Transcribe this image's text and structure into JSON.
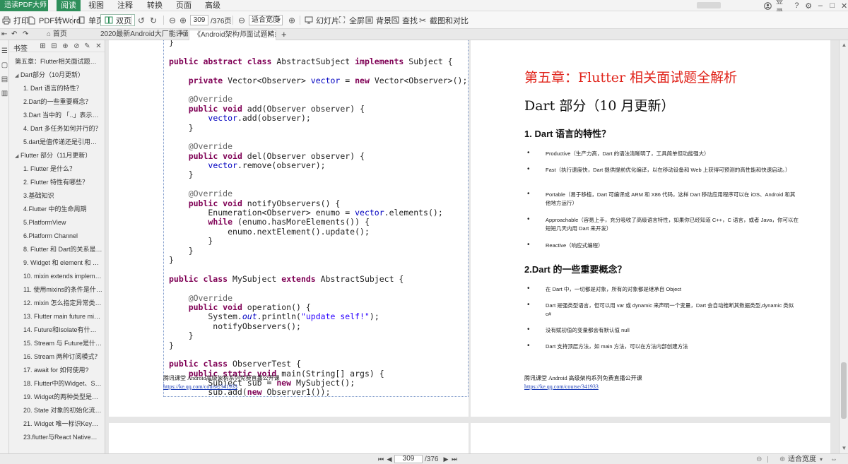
{
  "app": {
    "name": "迅读PDF大师",
    "accent": "#2f8f5b"
  },
  "menubar": {
    "items": [
      "阅读",
      "视图",
      "注释",
      "转换",
      "页面",
      "高级"
    ],
    "active_index": 0,
    "right": {
      "login_label": "登录"
    }
  },
  "toolbar": {
    "print_label": "打印",
    "pdf2word_label": "PDF转Word",
    "single_page_label": "单页",
    "double_page_label": "双页",
    "current_page": "309",
    "total_pages": "/376页",
    "zoom_value": "适合宽度",
    "slideshow_label": "幻灯片",
    "fullscreen_label": "全屏",
    "background_label": "背景",
    "find_label": "查找",
    "screenshot_label": "截图和对比"
  },
  "tabs": {
    "home_label": "首页",
    "items": [
      {
        "label": "2020最新Android大厂能评面..."
      },
      {
        "label": "《Android架构师面试题精编..."
      }
    ],
    "active_index": 1
  },
  "bookmarks": {
    "title": "书签",
    "items": [
      {
        "label": "第五章：Flutter相关面试题全解析",
        "level": 0,
        "expanded": false
      },
      {
        "label": "Dart部分（10月更新）",
        "level": 0,
        "expanded": true
      },
      {
        "label": "1. Dart 语言的特性？",
        "level": 1
      },
      {
        "label": "2.Dart的一些重要概念？",
        "level": 1
      },
      {
        "label": "3.Dart 当中的 「..」表示什么...",
        "level": 1
      },
      {
        "label": "4. Dart 多任务如何并行的？",
        "level": 1
      },
      {
        "label": "5.dart是值传递还是引用传递？",
        "level": 1
      },
      {
        "label": "Flutter 部分（11月更新）",
        "level": 0,
        "expanded": true
      },
      {
        "label": "1. Flutter 是什么？",
        "level": 1
      },
      {
        "label": "2. Flutter 特性有哪些？",
        "level": 1
      },
      {
        "label": "3.基础知识",
        "level": 1
      },
      {
        "label": "4.Flutter 中的生命周期",
        "level": 1
      },
      {
        "label": "5.PlatformView",
        "level": 1
      },
      {
        "label": "6.Platform Channel",
        "level": 1
      },
      {
        "label": "8. Flutter 和 Dart的关系是什...",
        "level": 1
      },
      {
        "label": "9. Widget 和 element 和 Re...",
        "level": 1
      },
      {
        "label": "10. mixin extends implemen...",
        "level": 1
      },
      {
        "label": "11. 使用mixins的条件是什么？",
        "level": 1
      },
      {
        "label": "12. mixin 怎么指定异常类型？",
        "level": 1
      },
      {
        "label": "13. Flutter main future mirot...",
        "level": 1
      },
      {
        "label": "14. Future和Isolate有什么区...",
        "level": 1
      },
      {
        "label": "15. Stream 与 Future是什么...",
        "level": 1
      },
      {
        "label": "16. Stream 两种订阅模式？",
        "level": 1
      },
      {
        "label": "17. await for 如何使用?",
        "level": 1
      },
      {
        "label": "18. Flutter中的Widget、Stat...",
        "level": 1
      },
      {
        "label": "19. Widget的两种类型是什么？",
        "level": 1
      },
      {
        "label": "20. State 对象的初始化流程？",
        "level": 1
      },
      {
        "label": "21. Widget 唯一标识Key有那...",
        "level": 1
      },
      {
        "label": "23.flutter与React Native有什...",
        "level": 1
      }
    ]
  },
  "left_page": {
    "code_lines": [
      [
        [
          "p",
          "}"
        ]
      ],
      [
        [
          "p",
          ""
        ]
      ],
      [
        [
          "k",
          "public abstract class"
        ],
        [
          "p",
          " AbstractSubject "
        ],
        [
          "k",
          "implements"
        ],
        [
          "p",
          " Subject {"
        ]
      ],
      [
        [
          "p",
          ""
        ]
      ],
      [
        [
          "p",
          "    "
        ],
        [
          "k",
          "private"
        ],
        [
          "p",
          " Vector<Observer> "
        ],
        [
          "f",
          "vector"
        ],
        [
          "p",
          " = "
        ],
        [
          "k",
          "new"
        ],
        [
          "p",
          " Vector<Observer>();"
        ]
      ],
      [
        [
          "p",
          ""
        ]
      ],
      [
        [
          "a",
          "    @Override"
        ]
      ],
      [
        [
          "p",
          "    "
        ],
        [
          "k",
          "public void"
        ],
        [
          "p",
          " add(Observer observer) {"
        ]
      ],
      [
        [
          "p",
          "        "
        ],
        [
          "f",
          "vector"
        ],
        [
          "p",
          ".add(observer);"
        ]
      ],
      [
        [
          "p",
          "    }"
        ]
      ],
      [
        [
          "p",
          ""
        ]
      ],
      [
        [
          "a",
          "    @Override"
        ]
      ],
      [
        [
          "p",
          "    "
        ],
        [
          "k",
          "public void"
        ],
        [
          "p",
          " del(Observer observer) {"
        ]
      ],
      [
        [
          "p",
          "        "
        ],
        [
          "f",
          "vector"
        ],
        [
          "p",
          ".remove(observer);"
        ]
      ],
      [
        [
          "p",
          "    }"
        ]
      ],
      [
        [
          "p",
          ""
        ]
      ],
      [
        [
          "a",
          "    @Override"
        ]
      ],
      [
        [
          "p",
          "    "
        ],
        [
          "k",
          "public void"
        ],
        [
          "p",
          " notifyObservers() {"
        ]
      ],
      [
        [
          "p",
          "        Enumeration<Observer> enumo = "
        ],
        [
          "f",
          "vector"
        ],
        [
          "p",
          ".elements();"
        ]
      ],
      [
        [
          "p",
          "        "
        ],
        [
          "k",
          "while"
        ],
        [
          "p",
          " (enumo.hasMoreElements()) {"
        ]
      ],
      [
        [
          "p",
          "            enumo.nextElement().update();"
        ]
      ],
      [
        [
          "p",
          "        }"
        ]
      ],
      [
        [
          "p",
          "    }"
        ]
      ],
      [
        [
          "p",
          "}"
        ]
      ],
      [
        [
          "p",
          ""
        ]
      ],
      [
        [
          "k",
          "public class"
        ],
        [
          "p",
          " MySubject "
        ],
        [
          "k",
          "extends"
        ],
        [
          "p",
          " AbstractSubject {"
        ]
      ],
      [
        [
          "p",
          ""
        ]
      ],
      [
        [
          "a",
          "    @Override"
        ]
      ],
      [
        [
          "p",
          "    "
        ],
        [
          "k",
          "public void"
        ],
        [
          "p",
          " operation() {"
        ]
      ],
      [
        [
          "p",
          "        System."
        ],
        [
          "s",
          "out"
        ],
        [
          "p",
          ".println("
        ],
        [
          "t",
          "\"update self!\""
        ],
        [
          "p",
          ");"
        ]
      ],
      [
        [
          "p",
          "         notifyObservers();"
        ]
      ],
      [
        [
          "p",
          "    }"
        ]
      ],
      [
        [
          "p",
          "}"
        ]
      ],
      [
        [
          "p",
          ""
        ]
      ],
      [
        [
          "k",
          "public class"
        ],
        [
          "p",
          " ObserverTest {"
        ]
      ],
      [
        [
          "p",
          "    "
        ],
        [
          "k",
          "public static void"
        ],
        [
          "p",
          " main(String[] args) {"
        ]
      ],
      [
        [
          "p",
          "        Subject sub = "
        ],
        [
          "k",
          "new"
        ],
        [
          "p",
          " MySubject();"
        ]
      ],
      [
        [
          "p",
          "        sub.add("
        ],
        [
          "k",
          "new"
        ],
        [
          "p",
          " Observer1());"
        ]
      ]
    ],
    "footer_text": "腾讯课堂 Android高级架构系列免费直播公开课",
    "footer_link": "https://ke.qq.com/course/341933"
  },
  "right_page": {
    "chapter_title": "第五章：Flutter 相关面试题全解析",
    "part_title": "Dart 部分（10 月更新）",
    "sections": [
      {
        "heading": "1. Dart  语言的特性？",
        "bullets": [
          "Productive（生产力高，Dart 的语法清晰明了，工具简单但功能强大）",
          "Fast（执行速度快，Dart 提供提前优化编译，以在移动设备和 Web 上获得可预测的高性能和快速启动。）",
          "Portable（易于移植，Dart 可编译成 ARM 和 X86 代码，这样 Dart 移动应用程序可以在 iOS、Android 和其他地方运行）",
          "Approachable（容易上手，充分吸收了高级语言特性，如果你已经知道 C++，C 语言，或者 Java，你可以在短短几天内用 Dart 来开发）",
          "Reactive（响应式编程）"
        ]
      },
      {
        "heading": "2.Dart 的一些重要概念？",
        "bullets": [
          "在 Dart 中，一切都是对象，所有的对象都是继承自 Object",
          "Dart 是强类型语言，但可以用 var 或 dynamic 来声明一个变量，Dart 会自动推断其数据类型,dynamic 类似 c#",
          "没有赋初值的变量都会有默认值 null",
          "Dart 支持顶层方法，如 main 方法，可以在方法内部创建方法"
        ]
      }
    ],
    "footer_text": "腾讯课堂 Android 高级架构系列免费直播公开课",
    "footer_link": "https://ke.qq.com/course/341933"
  },
  "statusbar": {
    "current_page": "309",
    "total_pages": "/376",
    "zoom_value": "适合宽度"
  }
}
